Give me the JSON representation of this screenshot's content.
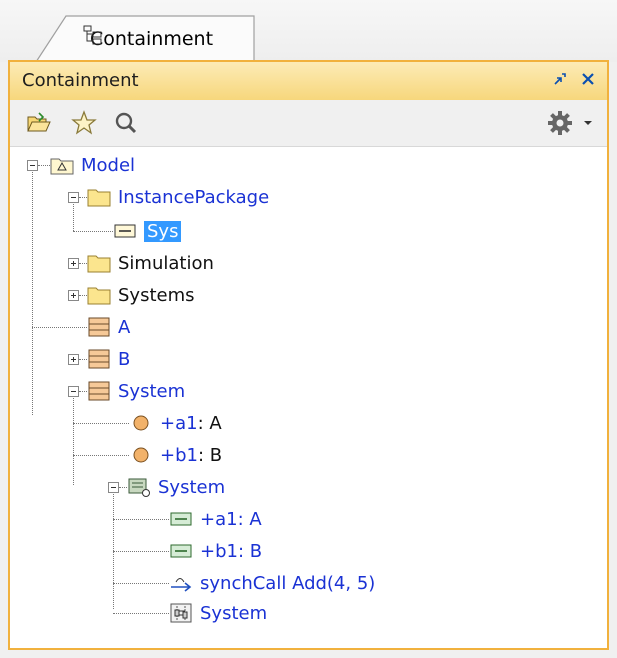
{
  "tab": {
    "label": "Containment"
  },
  "panel": {
    "title": "Containment",
    "restore_icon": "restore-icon",
    "close_icon": "close-icon"
  },
  "toolbar": {
    "buttons": [
      "open-folder-icon",
      "star-icon",
      "search-icon",
      "gear-icon",
      "dropdown-arrow-icon"
    ]
  },
  "tree": {
    "model": "Model",
    "instance_package": "InstancePackage",
    "sys": "Sys",
    "simulation": "Simulation",
    "systems": "Systems",
    "a": "A",
    "b": "B",
    "system": "System",
    "prop_a1_name": "+a1",
    "prop_a1_type": " : A",
    "prop_b1_name": "+b1",
    "prop_b1_type": " : B",
    "inner_system": "System",
    "part_a1_name": "+a1",
    "part_a1_type": " : A",
    "part_b1_name": "+b1",
    "part_b1_type": " : B",
    "synch_call": "synchCall Add(4, 5)",
    "diagram_system": "System"
  },
  "colors": {
    "link": "#1a32d4",
    "selection": "#3399ff",
    "panel_border": "#f1b13d"
  }
}
